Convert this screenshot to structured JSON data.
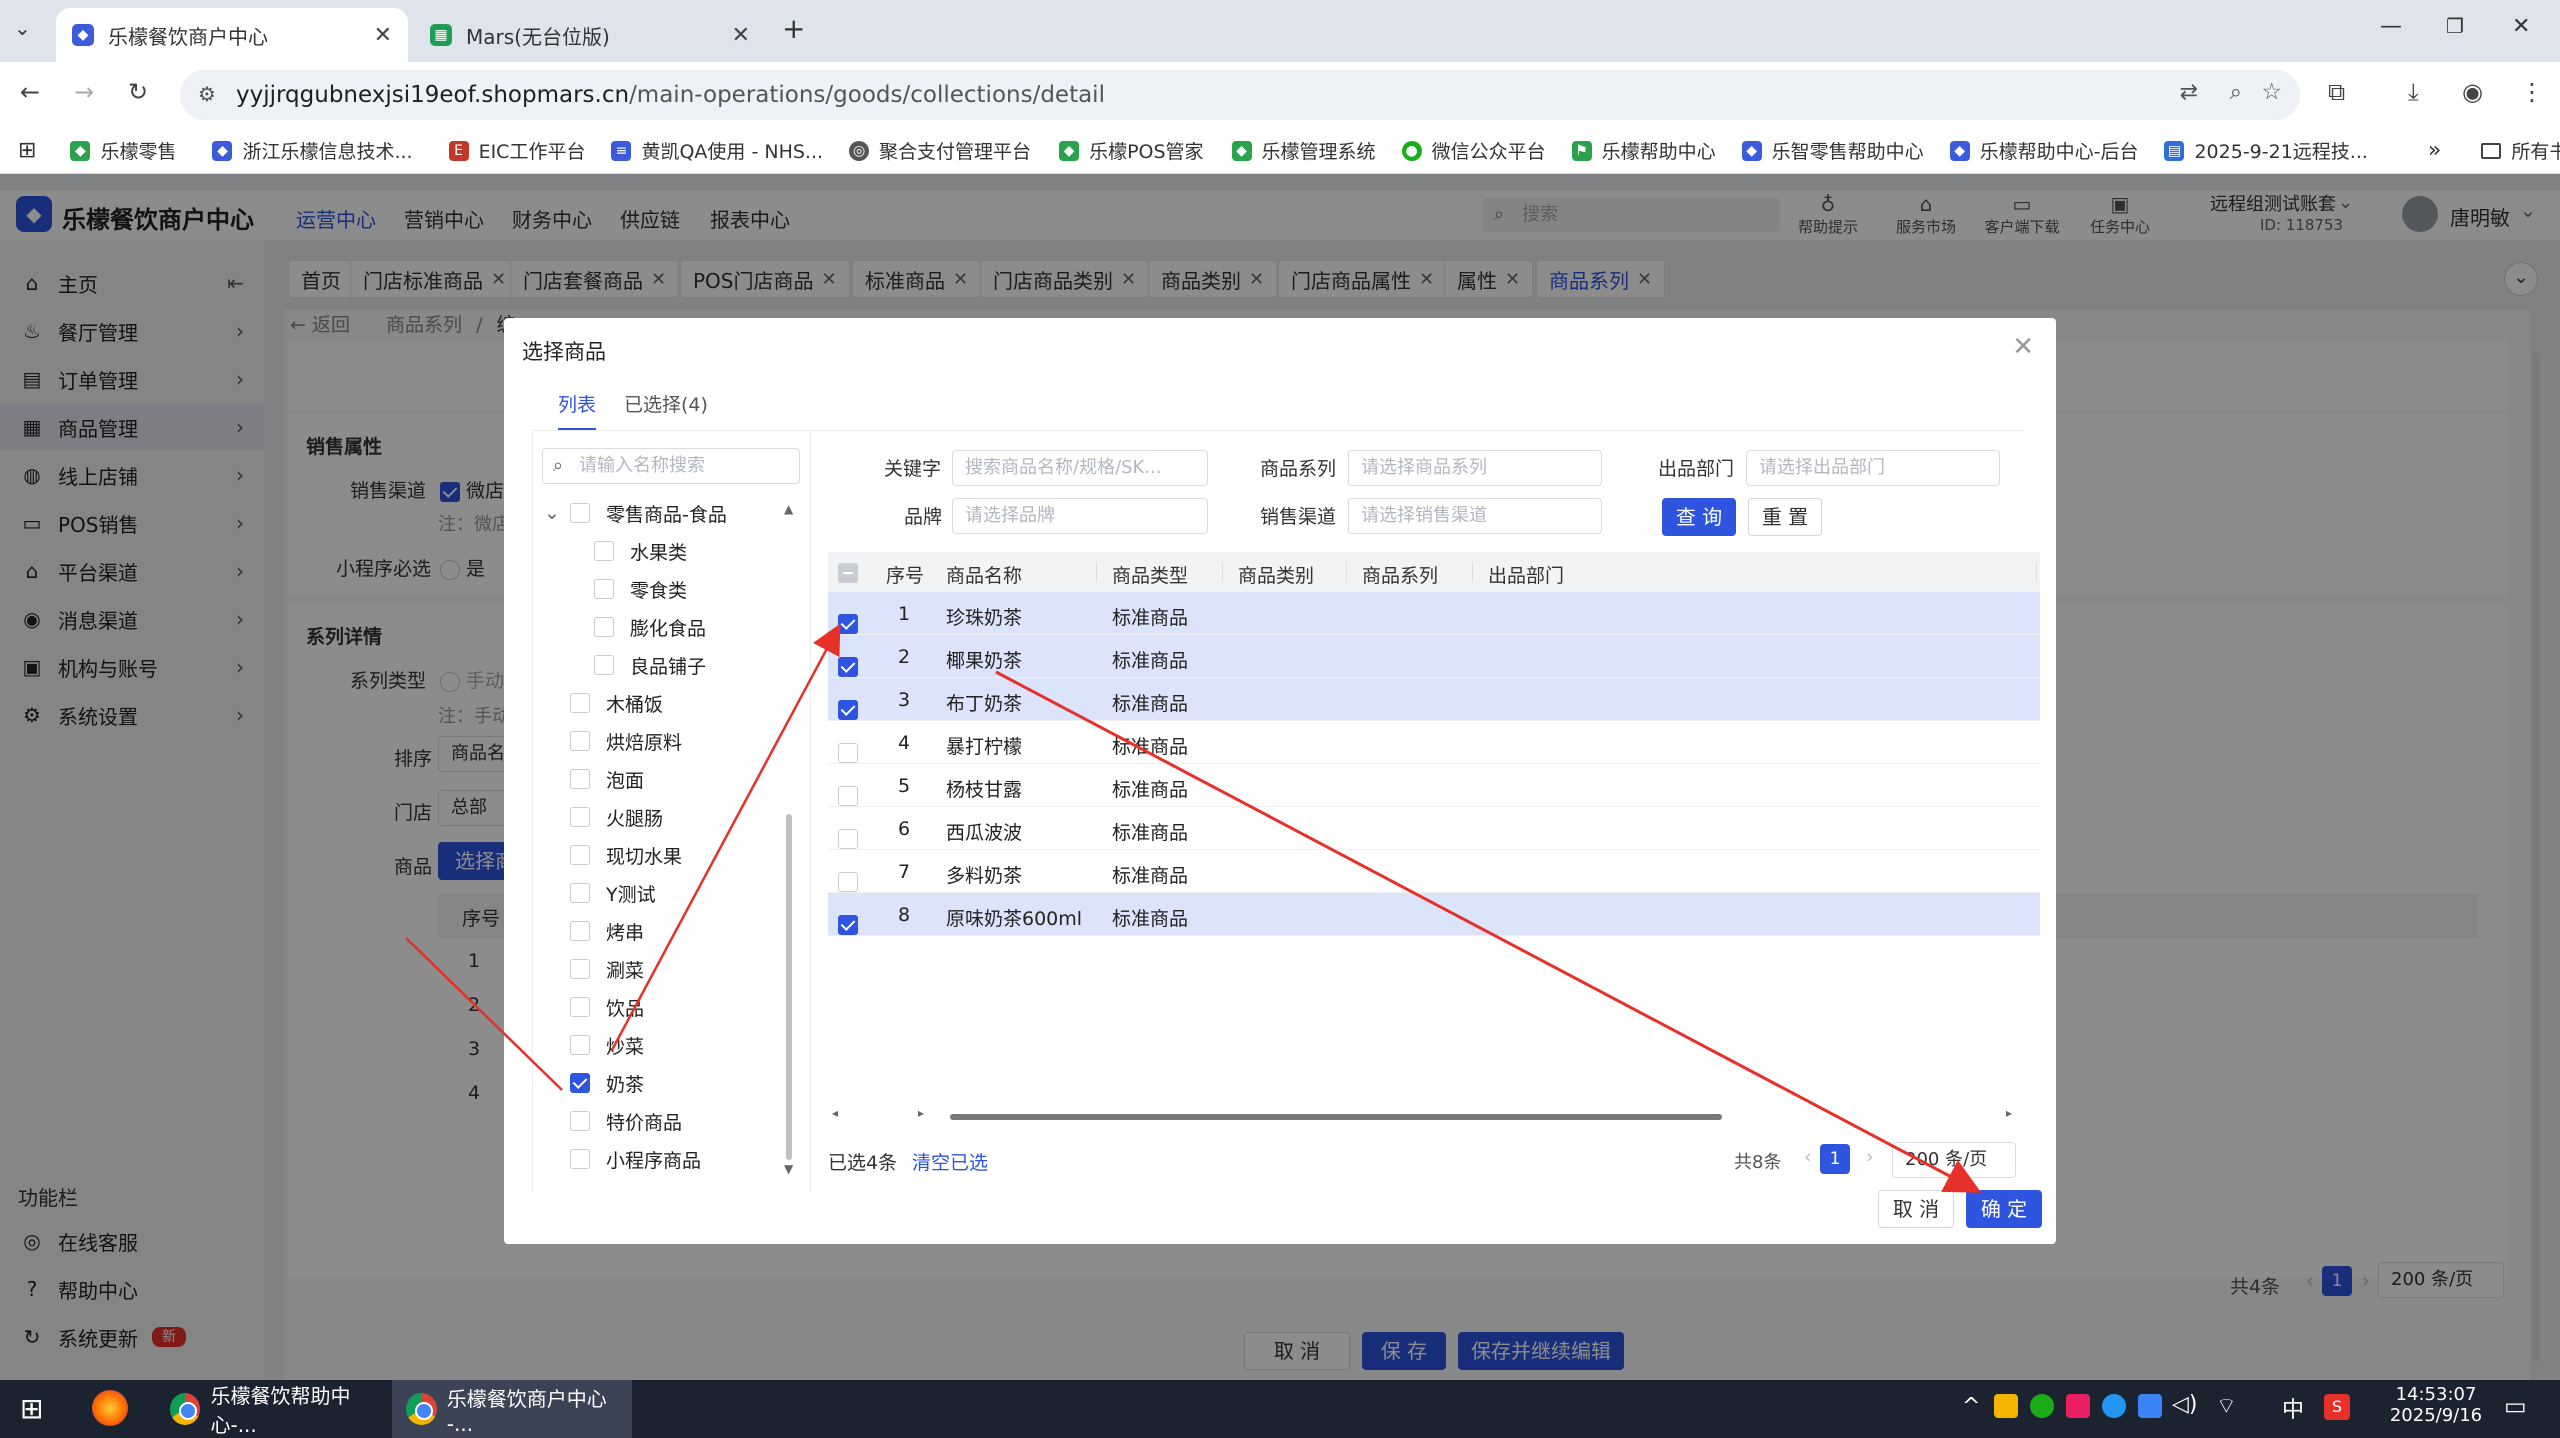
{
  "browser": {
    "tabs": [
      {
        "title": "乐檬餐饮商户中心",
        "active": true
      },
      {
        "title": "Mars(无台位版)",
        "active": false
      }
    ],
    "new_tab": "+",
    "url_host": "yyjjrqgubnexjsi19eof.shopmars.cn",
    "url_path": "/main-operations/goods/collections/detail",
    "bookmarks": [
      "乐檬零售",
      "浙江乐檬信息技术...",
      "EIC工作平台",
      "黄凯QA使用 - NHS...",
      "聚合支付管理平台",
      "乐檬POS管家",
      "乐檬管理系统",
      "微信公众平台",
      "乐檬帮助中心",
      "乐智零售帮助中心",
      "乐檬帮助中心-后台",
      "2025-9-21远程技..."
    ],
    "bookmarks_more": "»",
    "all_bookmarks": "所有书签"
  },
  "app": {
    "title": "乐檬餐饮商户中心",
    "nav": [
      "运营中心",
      "营销中心",
      "财务中心",
      "供应链",
      "报表中心"
    ],
    "search_placeholder": "搜索",
    "tools": [
      "帮助提示",
      "服务市场",
      "客户端下载",
      "任务中心"
    ],
    "account_name": "远程组测试账套",
    "account_id": "ID: 118753",
    "user": "唐明敏"
  },
  "sidebar": {
    "items": [
      "主页",
      "餐厅管理",
      "订单管理",
      "商品管理",
      "线上店铺",
      "POS销售",
      "平台渠道",
      "消息渠道",
      "机构与账号",
      "系统设置"
    ],
    "section": "功能栏",
    "func_items": [
      "在线客服",
      "帮助中心",
      "系统更新"
    ],
    "new_badge": "新"
  },
  "page_tabs": [
    "首页",
    "门店标准商品",
    "门店套餐商品",
    "POS门店商品",
    "标准商品",
    "门店商品类别",
    "商品类别",
    "门店商品属性",
    "属性",
    "商品系列"
  ],
  "breadcrumb": {
    "back": "返回",
    "path1": "商品系列",
    "sep": "/",
    "path2": "编"
  },
  "background_form": {
    "sales_title": "销售属性",
    "sales_channel_label": "销售渠道",
    "sales_channel_value": "微店",
    "note1": "注：微店",
    "mini_required_label": "小程序必选",
    "mini_required_value": "是",
    "series_title": "系列详情",
    "series_type_label": "系列类型",
    "series_type_value": "手动",
    "note2": "注：手动",
    "sort_label": "排序",
    "sort_value": "商品名",
    "store_label": "门店",
    "store_value": "总部",
    "goods_label": "商品",
    "goods_button": "选择商",
    "col_index": "序号",
    "rows": [
      "1",
      "2",
      "3",
      "4"
    ],
    "total": "共4条",
    "page": "1",
    "page_size": "200 条/页",
    "btn_cancel": "取 消",
    "btn_save": "保 存",
    "btn_save_continue": "保存并继续编辑"
  },
  "modal": {
    "title": "选择商品",
    "tabs": [
      "列表",
      "已选择(4)"
    ],
    "tree_search_placeholder": "请输入名称搜索",
    "tree": [
      {
        "label": "零售商品-食品",
        "level": 0,
        "expanded": true,
        "checked": false
      },
      {
        "label": "水果类",
        "level": 1,
        "checked": false
      },
      {
        "label": "零食类",
        "level": 1,
        "checked": false
      },
      {
        "label": "膨化食品",
        "level": 1,
        "checked": false
      },
      {
        "label": "良品铺子",
        "level": 1,
        "checked": false
      },
      {
        "label": "木桶饭",
        "level": 0,
        "checked": false
      },
      {
        "label": "烘焙原料",
        "level": 0,
        "checked": false
      },
      {
        "label": "泡面",
        "level": 0,
        "checked": false
      },
      {
        "label": "火腿肠",
        "level": 0,
        "checked": false
      },
      {
        "label": "现切水果",
        "level": 0,
        "checked": false
      },
      {
        "label": "Y测试",
        "level": 0,
        "checked": false
      },
      {
        "label": "烤串",
        "level": 0,
        "checked": false
      },
      {
        "label": "涮菜",
        "level": 0,
        "checked": false
      },
      {
        "label": "饮品",
        "level": 0,
        "checked": false
      },
      {
        "label": "炒菜",
        "level": 0,
        "checked": false
      },
      {
        "label": "奶茶",
        "level": 0,
        "checked": true
      },
      {
        "label": "特价商品",
        "level": 0,
        "checked": false
      },
      {
        "label": "小程序商品",
        "level": 0,
        "checked": false
      }
    ],
    "filters": {
      "keyword_label": "关键字",
      "keyword_placeholder": "搜索商品名称/规格/SK...",
      "series_label": "商品系列",
      "series_placeholder": "请选择商品系列",
      "dept_label": "出品部门",
      "dept_placeholder": "请选择出品部门",
      "brand_label": "品牌",
      "brand_placeholder": "请选择品牌",
      "channel_label": "销售渠道",
      "channel_placeholder": "请选择销售渠道",
      "query_button": "查 询",
      "reset_button": "重 置"
    },
    "columns": [
      "序号",
      "商品名称",
      "商品类型",
      "商品类别",
      "商品系列",
      "出品部门"
    ],
    "rows": [
      {
        "index": "1",
        "name": "珍珠奶茶",
        "type": "标准商品",
        "checked": true
      },
      {
        "index": "2",
        "name": "椰果奶茶",
        "type": "标准商品",
        "checked": true
      },
      {
        "index": "3",
        "name": "布丁奶茶",
        "type": "标准商品",
        "checked": true
      },
      {
        "index": "4",
        "name": "暴打柠檬",
        "type": "标准商品",
        "checked": false
      },
      {
        "index": "5",
        "name": "杨枝甘露",
        "type": "标准商品",
        "checked": false
      },
      {
        "index": "6",
        "name": "西瓜波波",
        "type": "标准商品",
        "checked": false
      },
      {
        "index": "7",
        "name": "多料奶茶",
        "type": "标准商品",
        "checked": false
      },
      {
        "index": "8",
        "name": "原味奶茶600ml",
        "type": "标准商品",
        "checked": true
      }
    ],
    "selected_count": "已选4条",
    "clear_selected": "清空已选",
    "total": "共8条",
    "page": "1",
    "page_size": "200 条/页",
    "cancel_button": "取 消",
    "confirm_button": "确 定"
  },
  "taskbar": {
    "apps": [
      "乐檬餐饮帮助中心-...",
      "乐檬餐饮商户中心 -..."
    ],
    "time": "14:53:07",
    "date": "2025/9/16",
    "ime": "中"
  },
  "colors": {
    "accent": "#2e54e0",
    "annotation": "#e8302a",
    "row_selected": "#dbe4fa"
  }
}
